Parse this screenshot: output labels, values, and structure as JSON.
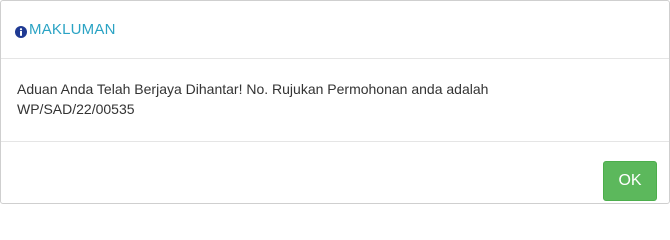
{
  "dialog": {
    "title": "MAKLUMAN",
    "title_icon": "info-circle-icon",
    "message_line1": "Aduan Anda Telah Berjaya Dihantar! No. Rujukan Permohonan anda adalah",
    "message_line2": "WP/SAD/22/00535",
    "ok_label": "OK"
  },
  "colors": {
    "title": "#2aa3c4",
    "icon": "#1f3a93",
    "ok_button": "#5cb85c",
    "text": "#333333"
  }
}
